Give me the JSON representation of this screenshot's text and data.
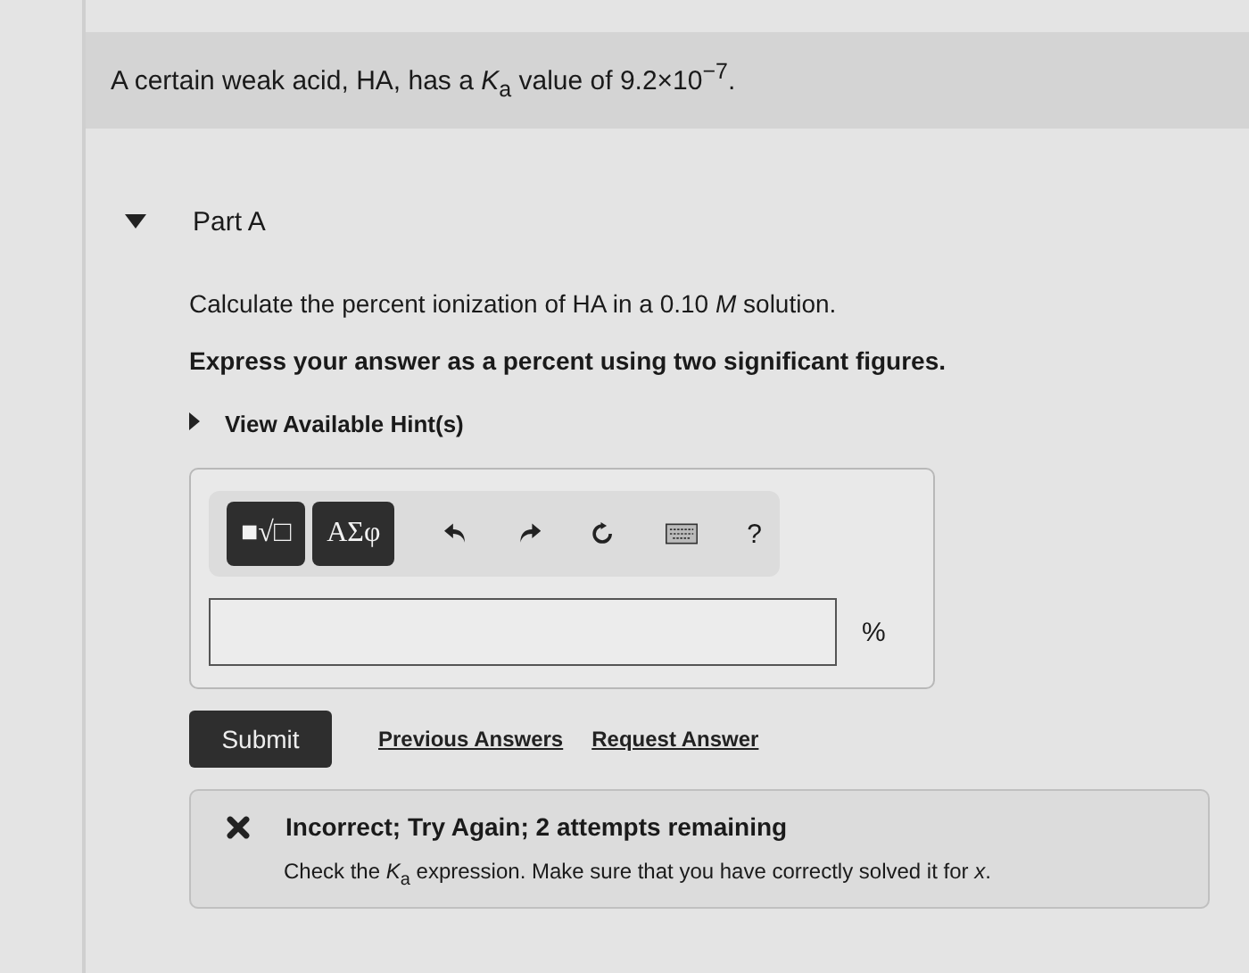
{
  "intro": "A certain weak acid, HA, has a *K*$_{a}$ value of 9.2×10$^{−7}$.",
  "part": {
    "title": "Part A",
    "expanded": true
  },
  "question": "Calculate the percent ionization of HA in a 0.10 *M* solution.",
  "instruction": "Express your answer as a percent using two significant figures.",
  "hints": {
    "label": "View Available Hint(s)",
    "expanded": false
  },
  "toolbar": {
    "template_button": "■√□",
    "greek_button": "ΑΣφ",
    "help": "?"
  },
  "answer": {
    "unit": "%"
  },
  "actions": {
    "submit": "Submit",
    "links": [
      "Previous Answers",
      "Request Answer"
    ]
  },
  "feedback": {
    "title": "Incorrect; Try Again; 2 attempts remaining",
    "message": "Check the *K*$_{a}$ expression. Make sure that you have correctly solved it for *x*."
  }
}
